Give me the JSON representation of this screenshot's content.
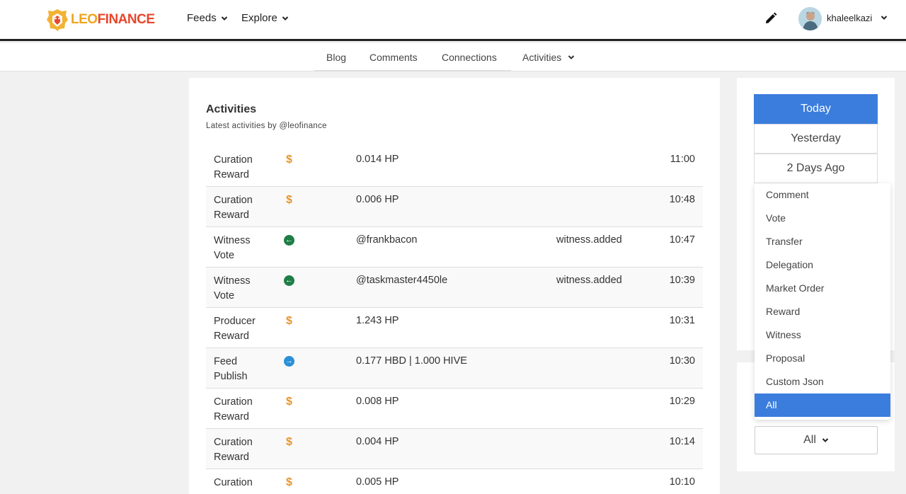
{
  "header": {
    "logo_leo": "LEO",
    "logo_finance": "FINANCE",
    "menus": [
      {
        "label": "Feeds"
      },
      {
        "label": "Explore"
      }
    ],
    "username": "khaleelkazi",
    "icons": {
      "edit": "pencil-icon",
      "user_menu": "chevron-down-icon"
    }
  },
  "subnav": {
    "tabs": [
      {
        "label": "Blog"
      },
      {
        "label": "Comments"
      },
      {
        "label": "Connections"
      },
      {
        "label": "Activities"
      }
    ]
  },
  "main": {
    "title": "Activities",
    "subtitle": "Latest activities by @leofinance",
    "rows": [
      {
        "type": "Curation Reward",
        "icon": "dollar-icon",
        "detail": "0.014 HP",
        "extra": "",
        "time": "11:00"
      },
      {
        "type": "Curation Reward",
        "icon": "dollar-icon",
        "detail": "0.006 HP",
        "extra": "",
        "time": "10:48"
      },
      {
        "type": "Witness Vote",
        "icon": "arrow-left-circle-icon",
        "detail": "@frankbacon",
        "extra": "witness.added",
        "time": "10:47"
      },
      {
        "type": "Witness Vote",
        "icon": "arrow-left-circle-icon",
        "detail": "@taskmaster4450le",
        "extra": "witness.added",
        "time": "10:39"
      },
      {
        "type": "Producer Reward",
        "icon": "dollar-icon",
        "detail": "1.243 HP",
        "extra": "",
        "time": "10:31"
      },
      {
        "type": "Feed Publish",
        "icon": "arrow-right-circle-icon",
        "detail": "0.177 HBD | 1.000 HIVE",
        "extra": "",
        "time": "10:30"
      },
      {
        "type": "Curation Reward",
        "icon": "dollar-icon",
        "detail": "0.008 HP",
        "extra": "",
        "time": "10:29"
      },
      {
        "type": "Curation Reward",
        "icon": "dollar-icon",
        "detail": "0.004 HP",
        "extra": "",
        "time": "10:14"
      },
      {
        "type": "Curation",
        "icon": "dollar-icon",
        "detail": "0.005 HP",
        "extra": "",
        "time": "10:10"
      }
    ],
    "colors": {
      "dollar": "#e8942b",
      "witness": "#1e7e45",
      "feed": "#2a8fd8"
    }
  },
  "sidebar": {
    "days": [
      {
        "label": "Today"
      },
      {
        "label": "Yesterday"
      },
      {
        "label": "2 Days Ago"
      }
    ],
    "filter_options": [
      {
        "label": "Comment"
      },
      {
        "label": "Vote"
      },
      {
        "label": "Transfer"
      },
      {
        "label": "Delegation"
      },
      {
        "label": "Market Order"
      },
      {
        "label": "Reward"
      },
      {
        "label": "Witness"
      },
      {
        "label": "Proposal"
      },
      {
        "label": "Custom Json"
      },
      {
        "label": "All"
      }
    ],
    "selected_filter": "All",
    "accent": "#3b7ddd"
  }
}
